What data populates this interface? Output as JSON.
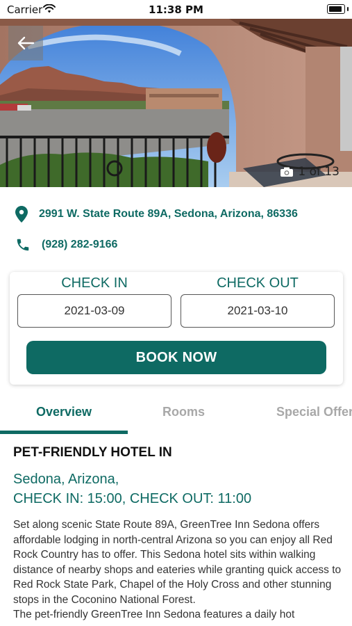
{
  "status_bar": {
    "carrier": "Carrier",
    "time": "11:38 PM"
  },
  "gallery": {
    "counter": "1 of 13",
    "current": 1,
    "total": 13
  },
  "contact": {
    "address": "2991 W. State Route 89A, Sedona, Arizona, 86336",
    "phone": "(928) 282-9166"
  },
  "booking": {
    "check_in_label": "CHECK IN",
    "check_out_label": "CHECK OUT",
    "check_in_date": "2021-03-09",
    "check_out_date": "2021-03-10",
    "book_label": "BOOK NOW"
  },
  "tabs": [
    {
      "label": "Overview",
      "active": true
    },
    {
      "label": "Rooms",
      "active": false
    },
    {
      "label": "Special Offers",
      "active": false
    }
  ],
  "overview": {
    "headline": "PET-FRIENDLY HOTEL IN",
    "location_line": "Sedona, Arizona,",
    "times_line": "CHECK IN: 15:00, CHECK OUT: 11:00",
    "paragraph1": "Set along scenic State Route 89A, GreenTree Inn Sedona offers affordable lodging in north-central Arizona so you can enjoy all Red Rock Country has to offer. This Sedona hotel sits within walking distance of nearby shops and eateries while granting quick access to Red Rock State Park, Chapel of the Holy Cross and other stunning stops in the Coconino National Forest.",
    "paragraph2": "The pet-friendly GreenTree Inn Sedona features a daily hot"
  },
  "colors": {
    "brand": "#0e6a63",
    "inactive_tab": "#a8a8a8"
  },
  "icons": [
    "wifi-icon",
    "battery-icon",
    "back-arrow-icon",
    "camera-icon",
    "location-pin-icon",
    "phone-icon"
  ]
}
